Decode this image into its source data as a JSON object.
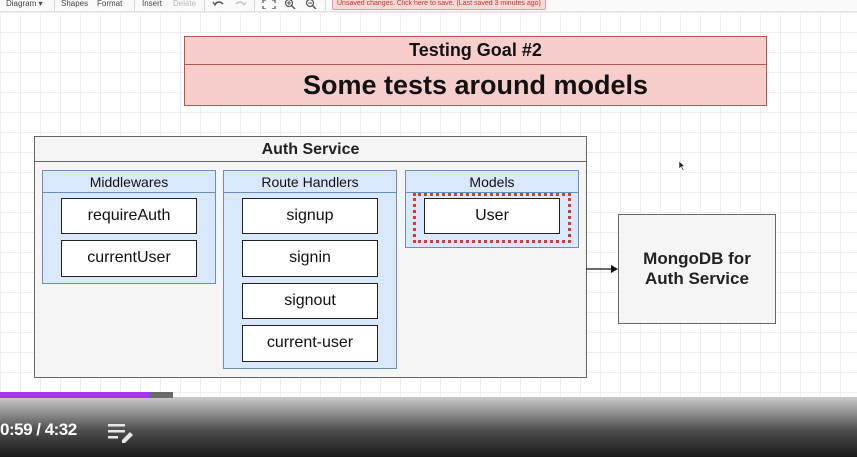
{
  "toolbar": {
    "diagram_label": "Diagram",
    "shapes_label": "Shapes",
    "format_label": "Format",
    "insert_label": "Insert",
    "delete_label": "Delete",
    "unsaved_notice": "Unsaved changes. Click here to save. (Last saved 3 minutes ago)"
  },
  "goal": {
    "title": "Testing Goal #2",
    "subtitle": "Some tests around models"
  },
  "service": {
    "title": "Auth Service",
    "groups": [
      {
        "title": "Middlewares",
        "items": [
          "requireAuth",
          "currentUser"
        ]
      },
      {
        "title": "Route Handlers",
        "items": [
          "signup",
          "signin",
          "signout",
          "current-user"
        ]
      },
      {
        "title": "Models",
        "items": [
          "User"
        ]
      }
    ]
  },
  "database": {
    "line1": "MongoDB for",
    "line2": "Auth Service"
  },
  "player": {
    "timecode": "0:59 / 4:32",
    "progress_fraction": 0.22
  },
  "colors": {
    "goal_fill": "#f8cecc",
    "goal_border": "#b85450",
    "group_fill": "#dae8fc",
    "group_border": "#6c8ebf",
    "highlight": "#e0362c",
    "progress": "#a435f0"
  }
}
